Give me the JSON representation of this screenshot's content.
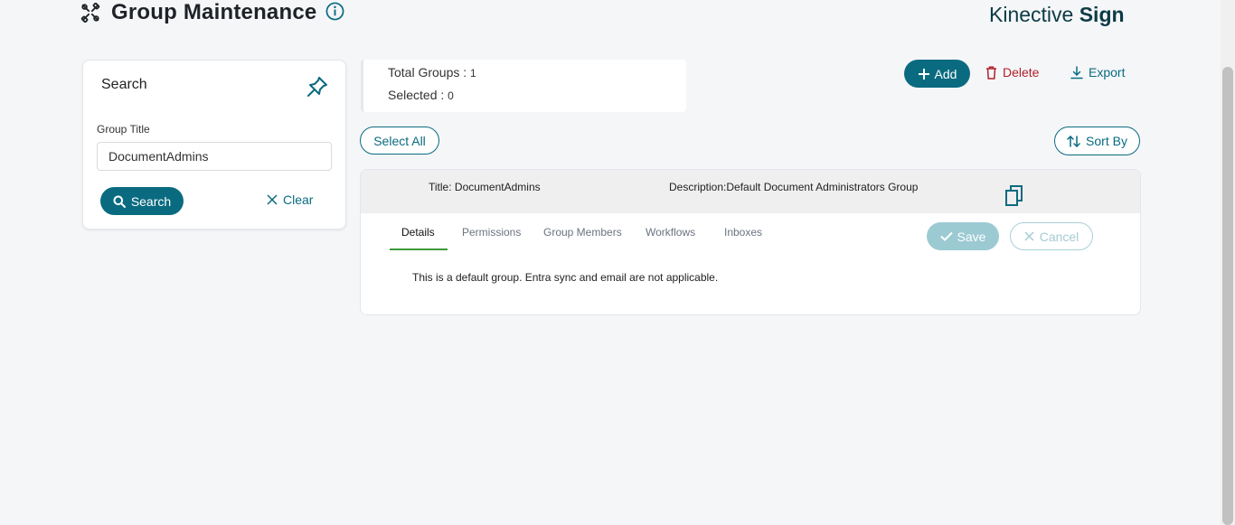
{
  "header": {
    "title": "Group Maintenance",
    "title_icon": "tools-icon",
    "info_icon": "info-icon",
    "brand_light": "Kinective",
    "brand_bold": "Sign"
  },
  "search_panel": {
    "title": "Search",
    "pin_icon": "pin-icon",
    "field_label": "Group Title",
    "field_value": "DocumentAdmins",
    "search_label": "Search",
    "clear_label": "Clear"
  },
  "stats": {
    "total_label": "Total Groups :",
    "total_value": "1",
    "selected_label": "Selected :",
    "selected_value": "0"
  },
  "actions": {
    "add_label": "Add",
    "delete_label": "Delete",
    "export_label": "Export",
    "select_all_label": "Select All",
    "sort_by_label": "Sort By"
  },
  "group": {
    "title_label": "Title:",
    "title_value": "DocumentAdmins",
    "description_label": "Description:",
    "description_value": "Default Document Administrators Group",
    "tabs": [
      "Details",
      "Permissions",
      "Group Members",
      "Workflows",
      "Inboxes"
    ],
    "active_tab": "Details",
    "save_label": "Save",
    "cancel_label": "Cancel",
    "details_text": "This is a default group. Entra sync and email are not applicable."
  },
  "colors": {
    "primary": "#0a6b80",
    "danger": "#b01f2a",
    "tab_active_underline": "#3d9a3b",
    "background": "#f5f6f8"
  }
}
